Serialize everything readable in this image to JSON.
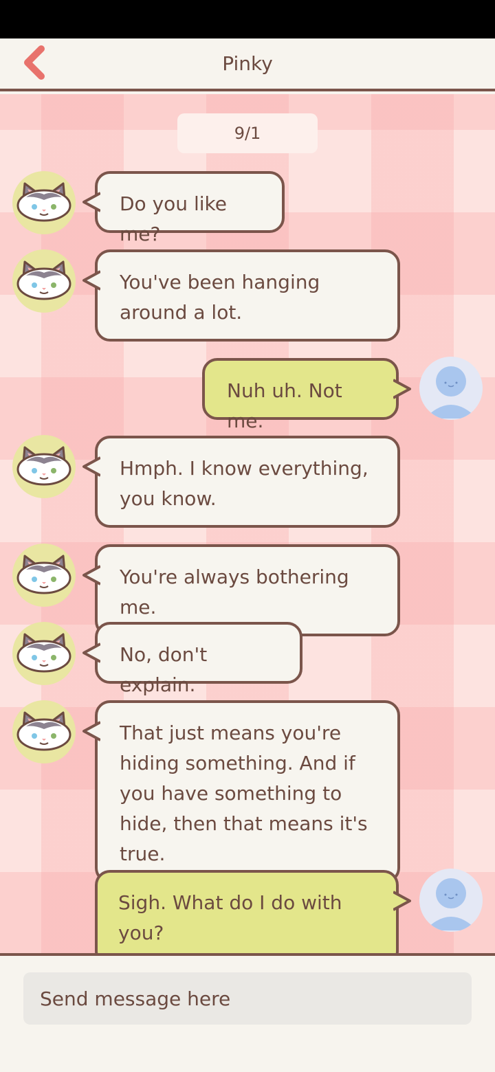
{
  "header": {
    "title": "Pinky",
    "back_icon": "chevron-left-icon",
    "accent_color": "#e8726c"
  },
  "chat": {
    "date": "9/1",
    "messages": [
      {
        "sender": "contact",
        "text": "Do you like me?"
      },
      {
        "sender": "contact",
        "text": "You've been hanging around a lot."
      },
      {
        "sender": "user",
        "text": "Nuh uh. Not me."
      },
      {
        "sender": "contact",
        "text": "Hmph. I know everything, you know."
      },
      {
        "sender": "contact",
        "text": "You're always bothering me."
      },
      {
        "sender": "contact",
        "text": "No, don't explain."
      },
      {
        "sender": "contact",
        "text": "That just means you're hiding something. And if you have something to hide, then that means it's true."
      },
      {
        "sender": "user",
        "text": "Sigh. What do I do with you?"
      }
    ]
  },
  "input": {
    "placeholder": "Send message here"
  },
  "colors": {
    "incoming_bubble": "#f7f5ef",
    "outgoing_bubble": "#e3e68b",
    "bubble_border": "#7b554b",
    "text": "#6b4a40",
    "chat_background": "#fde3e0"
  },
  "icons": {
    "contact_avatar": "cat-avatar-icon",
    "user_avatar": "user-avatar-icon"
  }
}
